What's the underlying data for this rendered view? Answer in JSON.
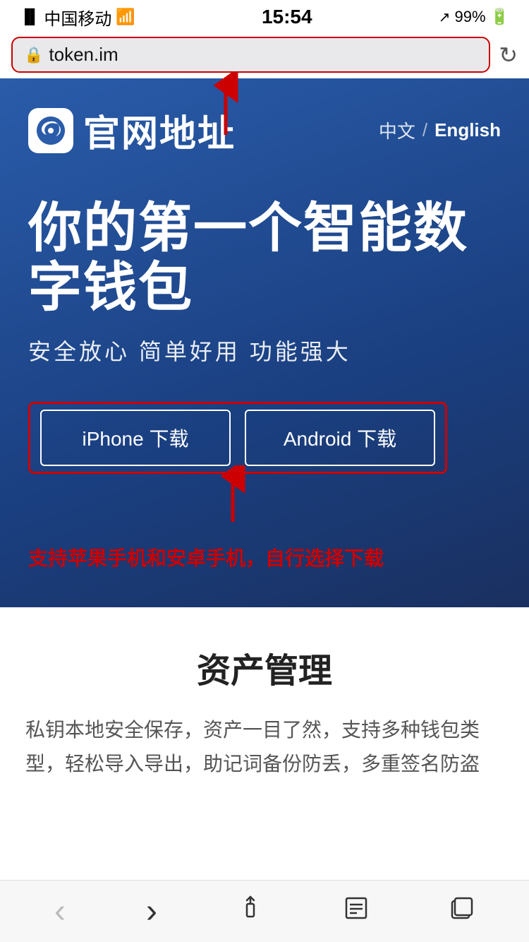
{
  "statusBar": {
    "carrier": "中国移动",
    "wifi": "WiFi",
    "time": "15:54",
    "location": "↗",
    "battery": "99%"
  },
  "addressBar": {
    "url": "token.im",
    "lockIcon": "🔒"
  },
  "hero": {
    "logoIcon": "e",
    "logoText": "官网地址",
    "langZh": "中文",
    "langSep": "/",
    "langEn": "English",
    "title": "你的第一个智能数字钱包",
    "subtitle": "安全放心  简单好用  功能强大",
    "iphone_btn": "iPhone 下载",
    "android_btn": "Android 下载",
    "annotation": "支持苹果手机和安卓手机，自行选择下载"
  },
  "assetSection": {
    "title": "资产管理",
    "desc": "私钥本地安全保存，资产一目了然，支持多种钱包类型，轻松导入导出，助记词备份防丢，多重签名防盗"
  },
  "toolbar": {
    "back": "‹",
    "forward": "›",
    "share": "⬆",
    "bookmarks": "📖",
    "tabs": "⬜"
  }
}
